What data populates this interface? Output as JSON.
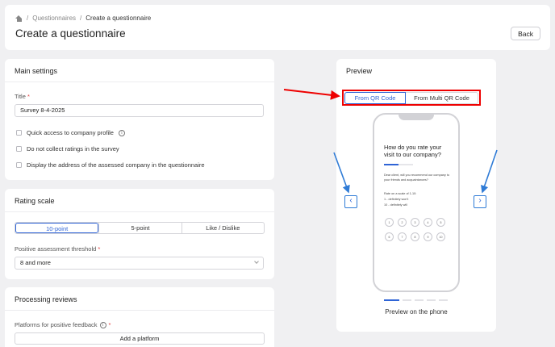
{
  "breadcrumb": {
    "items": [
      "Questionnaires",
      "Create a questionnaire"
    ],
    "separator": "/"
  },
  "page": {
    "title": "Create a questionnaire",
    "back_label": "Back"
  },
  "main_settings": {
    "heading": "Main settings",
    "title_label": "Title",
    "title_required": "*",
    "title_value": "Survey 8-4-2025",
    "checkboxes": [
      {
        "label": "Quick access to company profile",
        "checked": false
      },
      {
        "label": "Do not collect ratings in the survey",
        "checked": false
      },
      {
        "label": "Display the address of the assessed company in the questionnaire",
        "checked": false
      }
    ]
  },
  "rating_scale": {
    "heading": "Rating scale",
    "options": [
      "10-point",
      "5-point",
      "Like / Dislike"
    ],
    "selected": "10-point",
    "threshold_label": "Positive assessment threshold",
    "threshold_required": "*",
    "threshold_value": "8 and more"
  },
  "processing": {
    "heading": "Processing reviews",
    "platforms_label": "Platforms for positive feedback",
    "platforms_required": "*",
    "add_platform_label": "Add a platform"
  },
  "preview": {
    "heading": "Preview",
    "tabs": [
      "From QR Code",
      "From Multi QR Code"
    ],
    "selected_tab": "From QR Code",
    "phone": {
      "question": "How do you rate your visit to our company?",
      "intro": "Dear client, will you recommend our company to your friends and acquaintances?",
      "scale_line1": "Rate on a scale of 1-10:",
      "scale_line2": "1 - definitely won't",
      "scale_line3": "10 - definitely will",
      "ratings_row1": [
        "1",
        "2",
        "3",
        "4",
        "5"
      ],
      "ratings_row2": [
        "6",
        "7",
        "8",
        "9",
        "10"
      ]
    },
    "prev_icon": "‹",
    "next_icon": "›",
    "page_count": 5,
    "current_page": 1,
    "caption": "Preview on the phone"
  },
  "colors": {
    "accent": "#2f64d6",
    "annotation_red": "#e00000",
    "annotation_blue": "#2f7bd6"
  }
}
